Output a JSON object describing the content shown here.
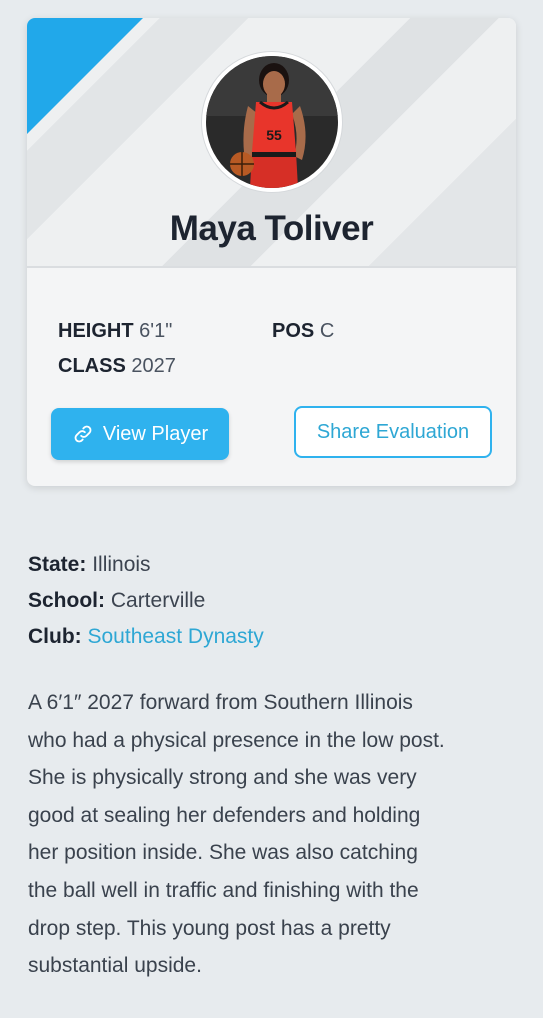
{
  "player": {
    "name": "Maya Toliver",
    "jersey_number": "55"
  },
  "stats": {
    "height_label": "HEIGHT",
    "height_value": "6'1\"",
    "pos_label": "POS",
    "pos_value": "C",
    "class_label": "CLASS",
    "class_value": "2027"
  },
  "buttons": {
    "view_player": "View Player",
    "share_evaluation": "Share Evaluation"
  },
  "details": {
    "state_label": "State:",
    "state_value": "Illinois",
    "school_label": "School:",
    "school_value": "Carterville",
    "club_label": "Club:",
    "club_value": "Southeast Dynasty"
  },
  "description_lines": [
    "A 6′1″ 2027 forward from Southern Illinois",
    "who had a physical presence in the low post.",
    "She is physically strong and she was very",
    "good at sealing her defenders and holding",
    "her position inside. She was also catching",
    "the ball well in traffic and finishing with the",
    "drop step. This young post has a pretty",
    "substantial upside."
  ],
  "colors": {
    "accent": "#2fb2ee",
    "corner": "#21a8ea",
    "link": "#2ea7d4",
    "background": "#e7ebee",
    "jersey": "#e8352b"
  },
  "icons": {
    "view_player": "link-icon"
  }
}
